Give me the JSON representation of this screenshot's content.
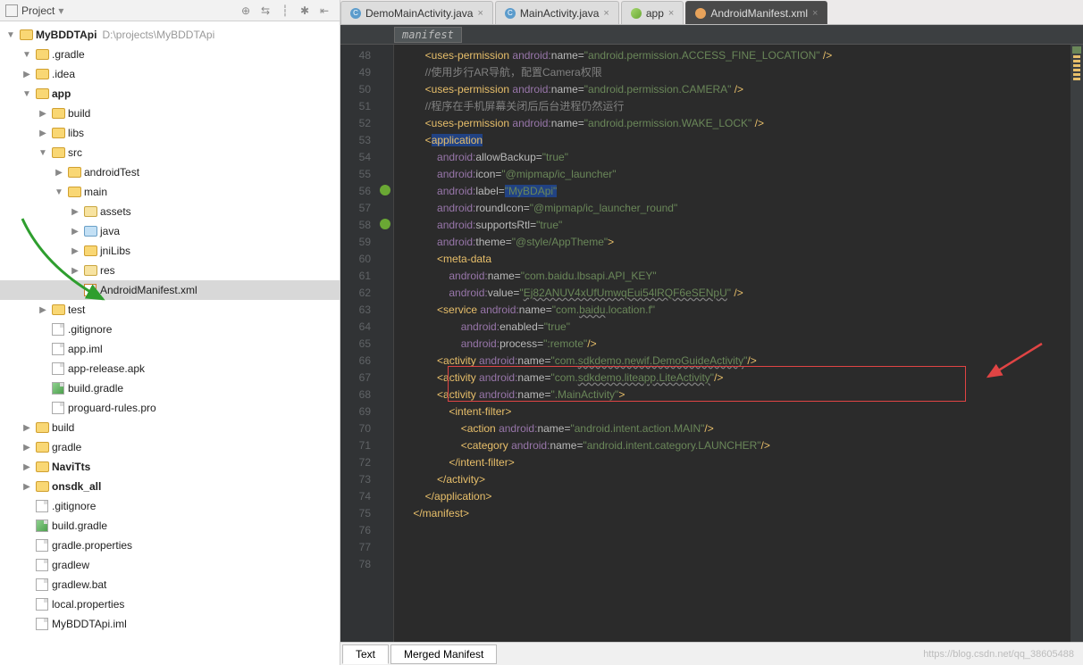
{
  "sidebar": {
    "title": "Project",
    "tool_icons": [
      "target-icon",
      "refresh-icon",
      "split-icon",
      "gear-icon",
      "collapse-icon"
    ]
  },
  "project": {
    "root": "MyBDDTApi",
    "root_path": "D:\\projects\\MyBDDTApi",
    "tree": [
      {
        "d": 1,
        "t": "fold",
        "arr": "▼",
        "name": ".gradle"
      },
      {
        "d": 1,
        "t": "fold",
        "arr": "▶",
        "name": ".idea"
      },
      {
        "d": 1,
        "t": "fold",
        "arr": "▼",
        "name": "app",
        "b": true
      },
      {
        "d": 2,
        "t": "fold",
        "arr": "▶",
        "name": "build"
      },
      {
        "d": 2,
        "t": "fold",
        "arr": "▶",
        "name": "libs"
      },
      {
        "d": 2,
        "t": "fold",
        "arr": "▼",
        "name": "src"
      },
      {
        "d": 3,
        "t": "fold",
        "arr": "▶",
        "name": "androidTest"
      },
      {
        "d": 3,
        "t": "fold",
        "arr": "▼",
        "name": "main"
      },
      {
        "d": 4,
        "t": "pkg",
        "arr": "▶",
        "name": "assets"
      },
      {
        "d": 4,
        "t": "open",
        "arr": "▶",
        "name": "java"
      },
      {
        "d": 4,
        "t": "fold",
        "arr": "▶",
        "name": "jniLibs"
      },
      {
        "d": 4,
        "t": "pkg",
        "arr": "▶",
        "name": "res"
      },
      {
        "d": 4,
        "t": "xml",
        "arr": "",
        "name": "AndroidManifest.xml",
        "sel": true
      },
      {
        "d": 2,
        "t": "fold",
        "arr": "▶",
        "name": "test"
      },
      {
        "d": 2,
        "t": "file",
        "arr": "",
        "name": ".gitignore"
      },
      {
        "d": 2,
        "t": "file",
        "arr": "",
        "name": "app.iml"
      },
      {
        "d": 2,
        "t": "file",
        "arr": "",
        "name": "app-release.apk"
      },
      {
        "d": 2,
        "t": "grad",
        "arr": "",
        "name": "build.gradle"
      },
      {
        "d": 2,
        "t": "file",
        "arr": "",
        "name": "proguard-rules.pro"
      },
      {
        "d": 1,
        "t": "fold",
        "arr": "▶",
        "name": "build"
      },
      {
        "d": 1,
        "t": "fold",
        "arr": "▶",
        "name": "gradle"
      },
      {
        "d": 1,
        "t": "fold",
        "arr": "▶",
        "name": "NaviTts",
        "b": true
      },
      {
        "d": 1,
        "t": "fold",
        "arr": "▶",
        "name": "onsdk_all",
        "b": true
      },
      {
        "d": 1,
        "t": "file",
        "arr": "",
        "name": ".gitignore"
      },
      {
        "d": 1,
        "t": "grad",
        "arr": "",
        "name": "build.gradle"
      },
      {
        "d": 1,
        "t": "file",
        "arr": "",
        "name": "gradle.properties"
      },
      {
        "d": 1,
        "t": "file",
        "arr": "",
        "name": "gradlew"
      },
      {
        "d": 1,
        "t": "file",
        "arr": "",
        "name": "gradlew.bat"
      },
      {
        "d": 1,
        "t": "file",
        "arr": "",
        "name": "local.properties"
      },
      {
        "d": 1,
        "t": "file",
        "arr": "",
        "name": "MyBDDTApi.iml"
      }
    ]
  },
  "tabs": [
    {
      "icon": "j",
      "text": "DemoMainActivity.java",
      "act": false
    },
    {
      "icon": "j",
      "text": "MainActivity.java",
      "act": false
    },
    {
      "icon": "a",
      "text": "app",
      "act": false
    },
    {
      "icon": "x",
      "text": "AndroidManifest.xml",
      "act": true
    }
  ],
  "breadcrumb": "manifest",
  "line_start": 48,
  "line_end": 78,
  "code": [
    {
      "n": 48,
      "i": 2,
      "h": "<span class='c-tag'>&lt;uses-permission</span> <span class='c-ns'>android:</span><span class='c-attr'>name=</span><span class='c-str'>\"android.permission.ACCESS_FINE_LOCATION\"</span> <span class='c-tag'>/&gt;</span>"
    },
    {
      "n": 49,
      "i": 2,
      "h": "<span class='c-cmt'>//使用步行AR导航，配置Camera权限</span>"
    },
    {
      "n": 50,
      "i": 2,
      "h": "<span class='c-tag'>&lt;uses-permission</span> <span class='c-ns'>android:</span><span class='c-attr'>name=</span><span class='c-str'>\"android.permission.CAMERA\"</span> <span class='c-tag'>/&gt;</span>"
    },
    {
      "n": 51,
      "i": 2,
      "h": "<span class='c-cmt'>//程序在手机屏幕关闭后后台进程仍然运行</span>"
    },
    {
      "n": 52,
      "i": 2,
      "h": "<span class='c-tag'>&lt;uses-permission</span> <span class='c-ns'>android:</span><span class='c-attr'>name=</span><span class='c-str'>\"android.permission.WAKE_LOCK\"</span> <span class='c-tag'>/&gt;</span>"
    },
    {
      "n": 53,
      "i": 0,
      "h": ""
    },
    {
      "n": 54,
      "i": 2,
      "h": "<span class='c-tag'>&lt;</span><span class='c-tag hl'>application</span>"
    },
    {
      "n": 55,
      "i": 3,
      "h": "<span class='c-ns'>android:</span><span class='c-attr'>allowBackup=</span><span class='c-str'>\"true\"</span>"
    },
    {
      "n": 56,
      "i": 3,
      "h": "<span class='c-ns'>android:</span><span class='c-attr'>icon=</span><span class='c-str'>\"@mipmap/ic_launcher\"</span>"
    },
    {
      "n": 57,
      "i": 3,
      "h": "<span class='c-ns'>android:</span><span class='c-attr'>label=</span><span class='c-str hl'>\"MyBDApi\"</span>"
    },
    {
      "n": 58,
      "i": 3,
      "h": "<span class='c-ns'>android:</span><span class='c-attr'>roundIcon=</span><span class='c-str'>\"@mipmap/ic_launcher_round\"</span>"
    },
    {
      "n": 59,
      "i": 3,
      "h": "<span class='c-ns'>android:</span><span class='c-attr'>supportsRtl=</span><span class='c-str'>\"true\"</span>"
    },
    {
      "n": 60,
      "i": 3,
      "h": "<span class='c-ns'>android:</span><span class='c-attr'>theme=</span><span class='c-str'>\"@style/AppTheme\"</span><span class='c-tag'>&gt;</span>"
    },
    {
      "n": 61,
      "i": 3,
      "h": "<span class='c-tag'>&lt;meta-data</span>"
    },
    {
      "n": 62,
      "i": 4,
      "h": "<span class='c-ns'>android:</span><span class='c-attr'>name=</span><span class='c-str'>\"com.baidu.lbsapi.API_KEY\"</span>"
    },
    {
      "n": 63,
      "i": 4,
      "h": "<span class='c-ns'>android:</span><span class='c-attr'>value=</span><span class='c-str'>\"<span class='warn'>Ej82ANUV4xUfUmwqEui54lRQF6eSENpU</span>\"</span> <span class='c-tag'>/&gt;</span>"
    },
    {
      "n": 64,
      "i": 3,
      "h": "<span class='c-tag'>&lt;service</span> <span class='c-ns'>android:</span><span class='c-attr'>name=</span><span class='c-str'>\"com.<span class='warn'>baidu</span>.location.f\"</span>"
    },
    {
      "n": 65,
      "i": 5,
      "h": "<span class='c-ns'>android:</span><span class='c-attr'>enabled=</span><span class='c-str'>\"true\"</span>"
    },
    {
      "n": 66,
      "i": 5,
      "h": "<span class='c-ns'>android:</span><span class='c-attr'>process=</span><span class='c-str'>\":remote\"</span><span class='c-tag'>/&gt;</span>"
    },
    {
      "n": 67,
      "i": 3,
      "h": "<span class='c-tag'>&lt;activity</span> <span class='c-ns'>android:</span><span class='c-attr'>name=</span><span class='c-str'>\"com.<span class='warn'>sdkdemo.newif.DemoGuideActivity</span>\"</span><span class='c-tag'>/&gt;</span>"
    },
    {
      "n": 68,
      "i": 3,
      "h": "<span class='c-tag'>&lt;activity</span> <span class='c-ns'>android:</span><span class='c-attr'>name=</span><span class='c-str'>\"com.<span class='warn'>sdkdemo.liteapp.LiteActivity</span>\"</span><span class='c-tag'>/&gt;</span>"
    },
    {
      "n": 69,
      "i": 3,
      "h": "<span class='c-tag'>&lt;activity</span> <span class='c-ns'>android:</span><span class='c-attr'>name=</span><span class='c-str'>\".MainActivity\"</span><span class='c-tag'>&gt;</span>"
    },
    {
      "n": 70,
      "i": 4,
      "h": "<span class='c-tag'>&lt;intent-filter&gt;</span>"
    },
    {
      "n": 71,
      "i": 5,
      "h": "<span class='c-tag'>&lt;action</span> <span class='c-ns'>android:</span><span class='c-attr'>name=</span><span class='c-str'>\"android.intent.action.MAIN\"</span><span class='c-tag'>/&gt;</span>"
    },
    {
      "n": 72,
      "i": 0,
      "h": ""
    },
    {
      "n": 73,
      "i": 5,
      "h": "<span class='c-tag'>&lt;category</span> <span class='c-ns'>android:</span><span class='c-attr'>name=</span><span class='c-str'>\"android.intent.category.LAUNCHER\"</span><span class='c-tag'>/&gt;</span>"
    },
    {
      "n": 74,
      "i": 4,
      "h": "<span class='c-tag'>&lt;/intent-filter&gt;</span>"
    },
    {
      "n": 75,
      "i": 3,
      "h": "<span class='c-tag'>&lt;/activity&gt;</span>"
    },
    {
      "n": 76,
      "i": 2,
      "h": "<span class='c-tag'>&lt;/application&gt;</span>"
    },
    {
      "n": 77,
      "i": 0,
      "h": ""
    },
    {
      "n": 78,
      "i": 1,
      "h": "<span class='c-tag'>&lt;/manifest&gt;</span>"
    }
  ],
  "bottom_tabs": [
    "Text",
    "Merged Manifest"
  ],
  "watermark": "https://blog.csdn.net/qq_38605488"
}
